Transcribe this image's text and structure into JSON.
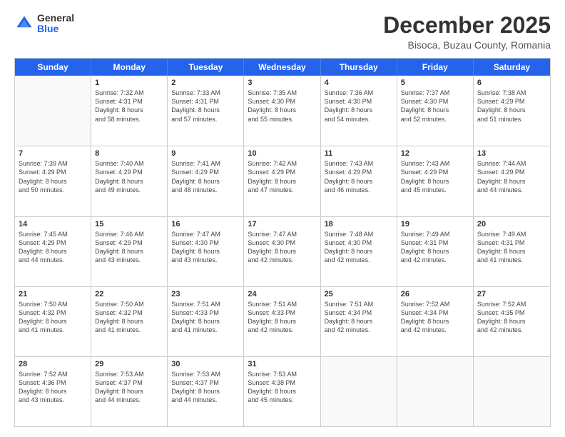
{
  "logo": {
    "general": "General",
    "blue": "Blue"
  },
  "title": "December 2025",
  "subtitle": "Bisoca, Buzau County, Romania",
  "header_days": [
    "Sunday",
    "Monday",
    "Tuesday",
    "Wednesday",
    "Thursday",
    "Friday",
    "Saturday"
  ],
  "weeks": [
    [
      {
        "day": "",
        "lines": []
      },
      {
        "day": "1",
        "lines": [
          "Sunrise: 7:32 AM",
          "Sunset: 4:31 PM",
          "Daylight: 8 hours",
          "and 58 minutes."
        ]
      },
      {
        "day": "2",
        "lines": [
          "Sunrise: 7:33 AM",
          "Sunset: 4:31 PM",
          "Daylight: 8 hours",
          "and 57 minutes."
        ]
      },
      {
        "day": "3",
        "lines": [
          "Sunrise: 7:35 AM",
          "Sunset: 4:30 PM",
          "Daylight: 8 hours",
          "and 55 minutes."
        ]
      },
      {
        "day": "4",
        "lines": [
          "Sunrise: 7:36 AM",
          "Sunset: 4:30 PM",
          "Daylight: 8 hours",
          "and 54 minutes."
        ]
      },
      {
        "day": "5",
        "lines": [
          "Sunrise: 7:37 AM",
          "Sunset: 4:30 PM",
          "Daylight: 8 hours",
          "and 52 minutes."
        ]
      },
      {
        "day": "6",
        "lines": [
          "Sunrise: 7:38 AM",
          "Sunset: 4:29 PM",
          "Daylight: 8 hours",
          "and 51 minutes."
        ]
      }
    ],
    [
      {
        "day": "7",
        "lines": [
          "Sunrise: 7:39 AM",
          "Sunset: 4:29 PM",
          "Daylight: 8 hours",
          "and 50 minutes."
        ]
      },
      {
        "day": "8",
        "lines": [
          "Sunrise: 7:40 AM",
          "Sunset: 4:29 PM",
          "Daylight: 8 hours",
          "and 49 minutes."
        ]
      },
      {
        "day": "9",
        "lines": [
          "Sunrise: 7:41 AM",
          "Sunset: 4:29 PM",
          "Daylight: 8 hours",
          "and 48 minutes."
        ]
      },
      {
        "day": "10",
        "lines": [
          "Sunrise: 7:42 AM",
          "Sunset: 4:29 PM",
          "Daylight: 8 hours",
          "and 47 minutes."
        ]
      },
      {
        "day": "11",
        "lines": [
          "Sunrise: 7:43 AM",
          "Sunset: 4:29 PM",
          "Daylight: 8 hours",
          "and 46 minutes."
        ]
      },
      {
        "day": "12",
        "lines": [
          "Sunrise: 7:43 AM",
          "Sunset: 4:29 PM",
          "Daylight: 8 hours",
          "and 45 minutes."
        ]
      },
      {
        "day": "13",
        "lines": [
          "Sunrise: 7:44 AM",
          "Sunset: 4:29 PM",
          "Daylight: 8 hours",
          "and 44 minutes."
        ]
      }
    ],
    [
      {
        "day": "14",
        "lines": [
          "Sunrise: 7:45 AM",
          "Sunset: 4:29 PM",
          "Daylight: 8 hours",
          "and 44 minutes."
        ]
      },
      {
        "day": "15",
        "lines": [
          "Sunrise: 7:46 AM",
          "Sunset: 4:29 PM",
          "Daylight: 8 hours",
          "and 43 minutes."
        ]
      },
      {
        "day": "16",
        "lines": [
          "Sunrise: 7:47 AM",
          "Sunset: 4:30 PM",
          "Daylight: 8 hours",
          "and 43 minutes."
        ]
      },
      {
        "day": "17",
        "lines": [
          "Sunrise: 7:47 AM",
          "Sunset: 4:30 PM",
          "Daylight: 8 hours",
          "and 42 minutes."
        ]
      },
      {
        "day": "18",
        "lines": [
          "Sunrise: 7:48 AM",
          "Sunset: 4:30 PM",
          "Daylight: 8 hours",
          "and 42 minutes."
        ]
      },
      {
        "day": "19",
        "lines": [
          "Sunrise: 7:49 AM",
          "Sunset: 4:31 PM",
          "Daylight: 8 hours",
          "and 42 minutes."
        ]
      },
      {
        "day": "20",
        "lines": [
          "Sunrise: 7:49 AM",
          "Sunset: 4:31 PM",
          "Daylight: 8 hours",
          "and 41 minutes."
        ]
      }
    ],
    [
      {
        "day": "21",
        "lines": [
          "Sunrise: 7:50 AM",
          "Sunset: 4:32 PM",
          "Daylight: 8 hours",
          "and 41 minutes."
        ]
      },
      {
        "day": "22",
        "lines": [
          "Sunrise: 7:50 AM",
          "Sunset: 4:32 PM",
          "Daylight: 8 hours",
          "and 41 minutes."
        ]
      },
      {
        "day": "23",
        "lines": [
          "Sunrise: 7:51 AM",
          "Sunset: 4:33 PM",
          "Daylight: 8 hours",
          "and 41 minutes."
        ]
      },
      {
        "day": "24",
        "lines": [
          "Sunrise: 7:51 AM",
          "Sunset: 4:33 PM",
          "Daylight: 8 hours",
          "and 42 minutes."
        ]
      },
      {
        "day": "25",
        "lines": [
          "Sunrise: 7:51 AM",
          "Sunset: 4:34 PM",
          "Daylight: 8 hours",
          "and 42 minutes."
        ]
      },
      {
        "day": "26",
        "lines": [
          "Sunrise: 7:52 AM",
          "Sunset: 4:34 PM",
          "Daylight: 8 hours",
          "and 42 minutes."
        ]
      },
      {
        "day": "27",
        "lines": [
          "Sunrise: 7:52 AM",
          "Sunset: 4:35 PM",
          "Daylight: 8 hours",
          "and 42 minutes."
        ]
      }
    ],
    [
      {
        "day": "28",
        "lines": [
          "Sunrise: 7:52 AM",
          "Sunset: 4:36 PM",
          "Daylight: 8 hours",
          "and 43 minutes."
        ]
      },
      {
        "day": "29",
        "lines": [
          "Sunrise: 7:53 AM",
          "Sunset: 4:37 PM",
          "Daylight: 8 hours",
          "and 44 minutes."
        ]
      },
      {
        "day": "30",
        "lines": [
          "Sunrise: 7:53 AM",
          "Sunset: 4:37 PM",
          "Daylight: 8 hours",
          "and 44 minutes."
        ]
      },
      {
        "day": "31",
        "lines": [
          "Sunrise: 7:53 AM",
          "Sunset: 4:38 PM",
          "Daylight: 8 hours",
          "and 45 minutes."
        ]
      },
      {
        "day": "",
        "lines": []
      },
      {
        "day": "",
        "lines": []
      },
      {
        "day": "",
        "lines": []
      }
    ]
  ]
}
